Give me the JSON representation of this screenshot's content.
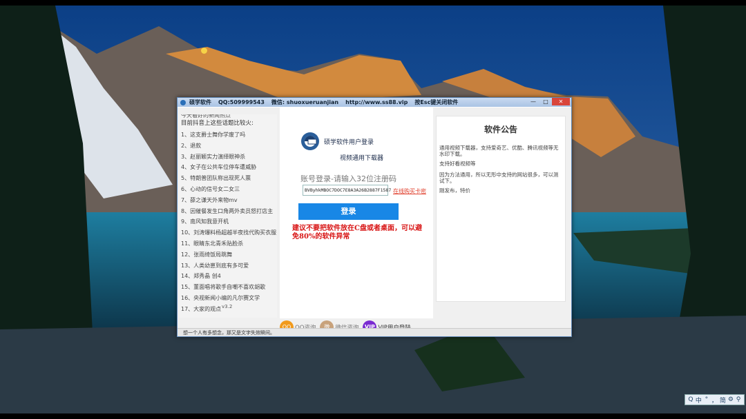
{
  "window": {
    "app_name": "硕学软件",
    "qq": "QQ:509999543",
    "wechat": "微信: shuoxueruanjian",
    "website": "http://www.ss88.vip",
    "esc_hint": "按Esc键关闭软件",
    "controls": {
      "minimize": "—",
      "maximize": "□",
      "close": "✕"
    }
  },
  "news": {
    "cut_line": "今天看好的新闻热点",
    "heading": "目前抖音上这些话题比较火:",
    "items": [
      "1、这支爵士舞你学废了吗",
      "2、退款",
      "3、赵丽颖实力演绎眼神杀",
      "4、女子在公共车位停车遭威胁",
      "5、特朗普团队称出现死人票",
      "6、心动的信号女二女三",
      "7、薛之谦天外来物mv",
      "8、因催餐发生口角两外卖员怒打店主",
      "9、南风知我意开机",
      "10、刘涛爆料杨超越半夜找代购买衣服",
      "11、眼睛东北青禾贴脸杀",
      "12、张雨绮饭局跳舞",
      "13、人类幼崽到底有多可爱",
      "14、郑秀晶 创4",
      "15、董面唱将歌手自嘲不喜欢胡歌",
      "16、央视新闻小编的凡尔赛文学",
      "17、大家的观点"
    ],
    "version": "v3.2"
  },
  "login": {
    "brand": "硕学软件用户登录",
    "subbrand": "视频通用下载器",
    "label": "账号登录-请输入32位注册码",
    "code_value": "BVByhkMBOC7DOC7E8A3A26B2887F1587",
    "buy_link": "在线购买卡密",
    "button": "登录",
    "warning": "建议不要把软件放在C盘或者桌面，可以避免80%的软件异常"
  },
  "notice": {
    "title": "软件公告",
    "lines": [
      "通用视频下载器，支持爱奇艺、优酷、腾讯视频等无水印下载。",
      "支持好看视频等",
      "因为方法通用，所以无形中支持的网站很多，可以测试下。",
      "刚发布，特价"
    ]
  },
  "services": {
    "qq_label": "QQ咨询",
    "qq_icon_text": "QQ",
    "wechat_label": "微信咨询",
    "wechat_icon_text": "微",
    "vip_icon_text": "VIP",
    "vip_label": "VIP用户登陆"
  },
  "status": "想一个人有多想念，那又是文字失效瞬间。",
  "taskbar_ime": [
    "Q",
    "中",
    "°",
    "，",
    "简",
    "⚙",
    "⚲"
  ]
}
